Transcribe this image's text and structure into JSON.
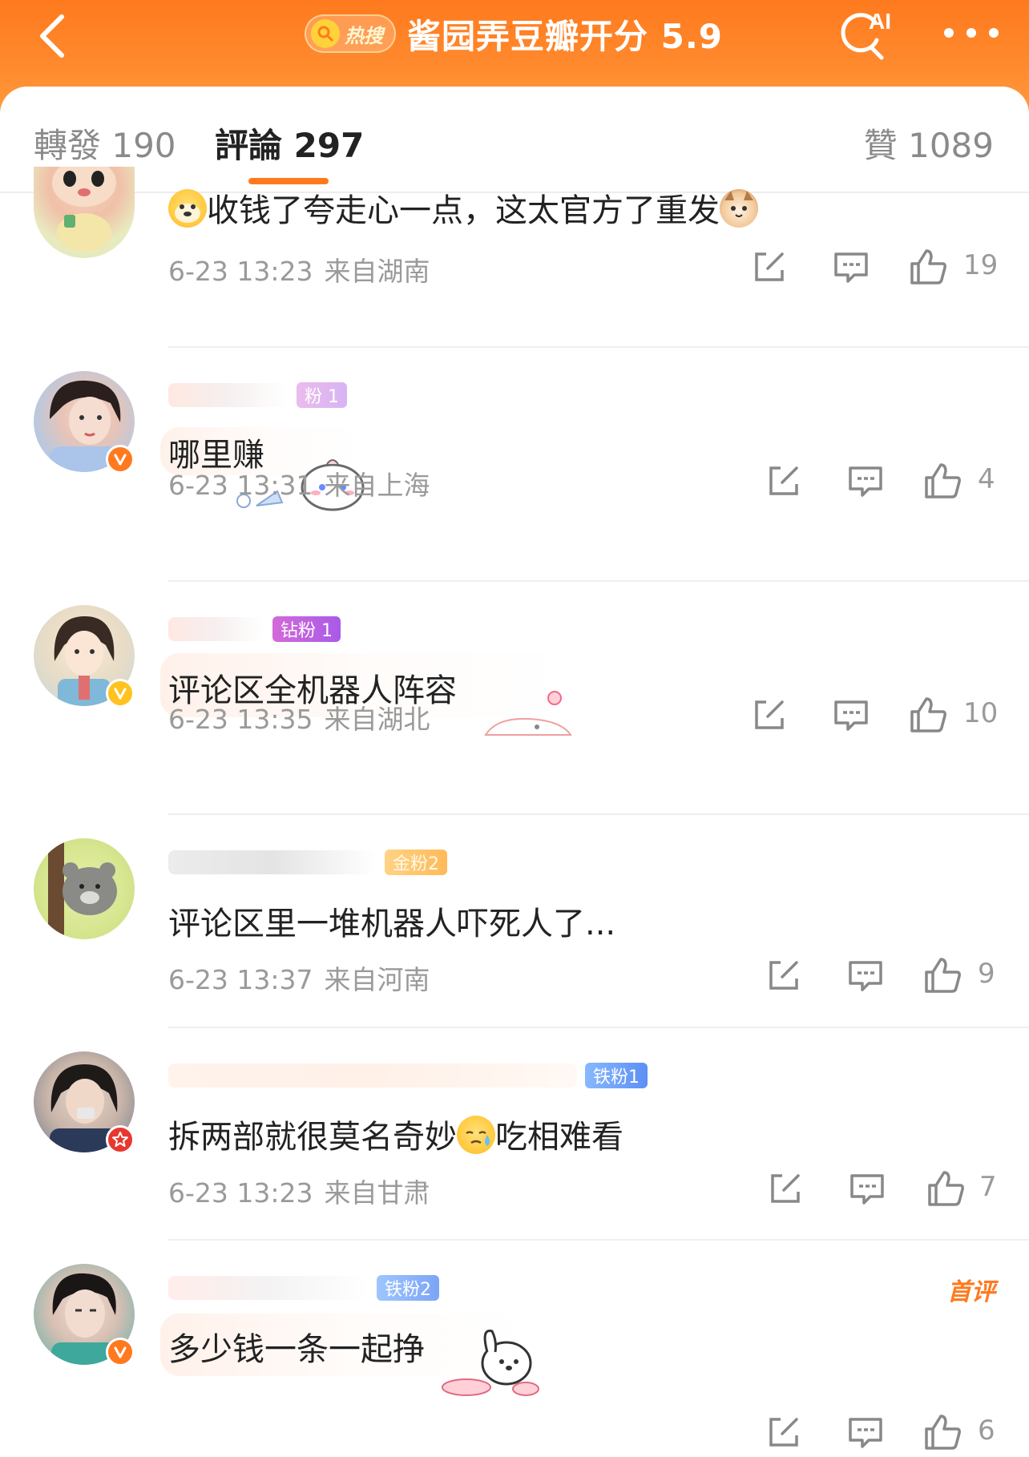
{
  "topbar": {
    "hot_badge": "热搜",
    "title": "酱园弄豆瓣开分 5.9",
    "ai_label": "AI",
    "colors": {
      "accent": "#ff7a1e",
      "background": "#ff8a2e"
    },
    "icons": [
      "back-arrow-icon",
      "search-icon",
      "ai-search-icon",
      "more-icon"
    ]
  },
  "tabs": [
    {
      "label": "轉發 190",
      "active": false
    },
    {
      "label": "評論 297",
      "active": true
    },
    {
      "label": "贊 1089",
      "active": false
    }
  ],
  "comments": [
    {
      "text_before": "",
      "text_after": "收钱了夸走心一点，这太官方了重发",
      "emoji_before": "doge-emoji",
      "emoji_after": "cat-emoji",
      "fan_badge": "",
      "time": "6-23 13:23",
      "location": "来自湖南",
      "likes": "19",
      "verified": "none",
      "first": false
    },
    {
      "text_before": "哪里赚",
      "text_after": "",
      "fan_badge": "粉 1",
      "time": "6-23 13:31",
      "location": "来自上海",
      "likes": "4",
      "verified": "orange",
      "first": false
    },
    {
      "text_before": "评论区全机器人阵容",
      "text_after": "",
      "fan_badge": "钻粉 1",
      "time": "6-23 13:35",
      "location": "来自湖北",
      "likes": "10",
      "verified": "yellow",
      "first": false
    },
    {
      "text_before": "评论区里一堆机器人吓死人了...",
      "text_after": "",
      "fan_badge": "金粉2",
      "time": "6-23 13:37",
      "location": "来自河南",
      "likes": "9",
      "verified": "none",
      "first": false
    },
    {
      "text_before": "拆两部就很莫名奇妙",
      "text_after": "吃相难看",
      "emoji_mid": "sweat-emoji",
      "fan_badge": "铁粉1",
      "time": "6-23 13:23",
      "location": "来自甘肃",
      "likes": "7",
      "verified": "red",
      "first": false
    },
    {
      "text_before": "多少钱一条一起挣",
      "text_after": "",
      "fan_badge": "铁粉2",
      "first_label": "首评",
      "time": "",
      "location": "",
      "likes": "6",
      "verified": "orange",
      "first": true
    }
  ]
}
